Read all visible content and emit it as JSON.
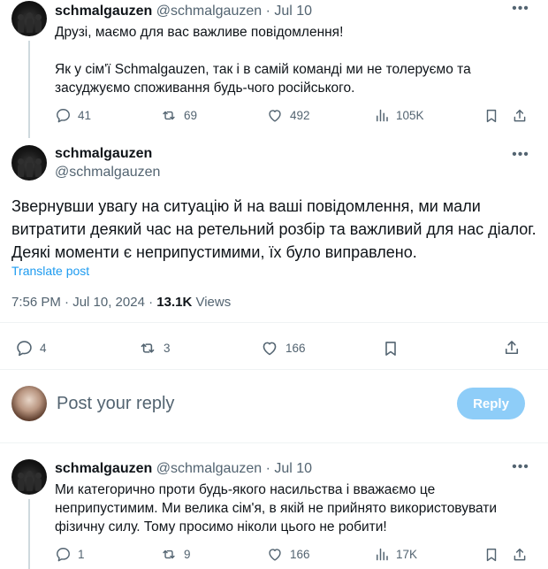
{
  "tweet1": {
    "name": "schmalgauzen",
    "handle": "@schmalgauzen",
    "date": "· Jul 10",
    "line1": "Друзі, маємо для вас важливе повідомлення!",
    "line2": "Як у сім'ї Schmalgauzen, так і в самій команді ми не толеруємо та",
    "line3": "засуджуємо споживання будь-чого російського.",
    "replies": "41",
    "reposts": "69",
    "likes": "492",
    "views": "105K"
  },
  "main_tweet": {
    "name": "schmalgauzen",
    "handle": "@schmalgauzen",
    "line1": "Звернувши увагу на ситуацію й на ваші повідомлення, ми мали",
    "line2": "витратити деякий час на ретельний розбір та важливий для нас діалог.",
    "line3": "Деякі моменти є неприпустимими, їх було виправлено.",
    "translate": "Translate post",
    "timestamp": "7:56 PM · Jul 10, 2024 · ",
    "views_count": "13.1K",
    "views_label": " Views",
    "replies": "4",
    "reposts": "3",
    "likes": "166"
  },
  "reply_box": {
    "placeholder": "Post your reply",
    "button": "Reply"
  },
  "tweet3": {
    "name": "schmalgauzen",
    "handle": "@schmalgauzen",
    "date": "· Jul 10",
    "line1": "Ми категорично проти будь-якого насильства і вважаємо це",
    "line2": "неприпустимим. Ми велика сім'я, в якій не прийнято використовувати",
    "line3": "фізичну силу. Тому просимо ніколи цього не робити!",
    "replies": "1",
    "reposts": "9",
    "likes": "166",
    "views": "17K"
  },
  "colors": {
    "accent": "#1d9bf0",
    "reply_button_disabled": "#8ecdf8",
    "muted_text": "#536471"
  },
  "icons": [
    "more-icon",
    "reply-icon",
    "repost-icon",
    "like-icon",
    "views-icon",
    "bookmark-icon",
    "share-icon"
  ]
}
